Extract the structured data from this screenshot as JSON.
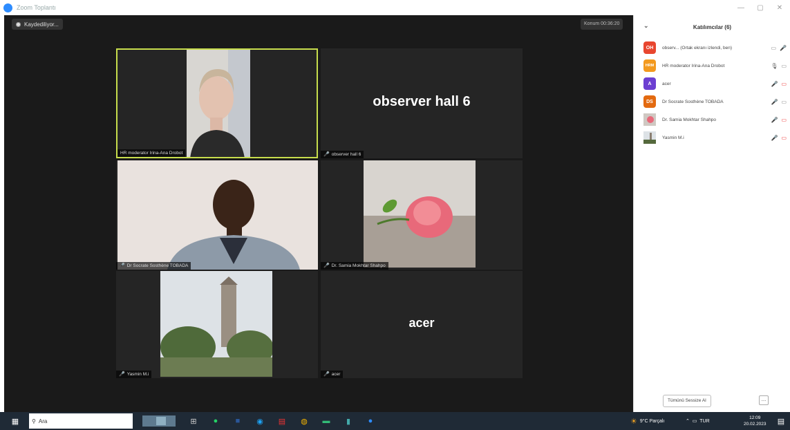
{
  "window": {
    "title": "Zoom Toplantı",
    "controls": [
      "—",
      "▢",
      "✕"
    ]
  },
  "toolbar": {
    "recording_label": "Kaydediliyor...",
    "view_label": "Konum 00:36:20"
  },
  "tiles": [
    {
      "name": "HR moderator Irina-Ana Drobot",
      "muted": false,
      "active": true,
      "kind": "video-woman"
    },
    {
      "name": "observer hall 6",
      "muted": true,
      "active": false,
      "kind": "text",
      "big_text": "observer hall 6"
    },
    {
      "name": "Dr Socrate Sosthène TOBADA",
      "muted": true,
      "active": false,
      "kind": "video-man"
    },
    {
      "name": "Dr. Samia Mokhtar Shahpo",
      "muted": true,
      "active": false,
      "kind": "image-rose"
    },
    {
      "name": "Yasmin M.i",
      "muted": true,
      "active": false,
      "kind": "image-tower"
    },
    {
      "name": "acer",
      "muted": true,
      "active": false,
      "kind": "text",
      "big_text": "acer"
    }
  ],
  "panel": {
    "title": "Katılımcılar (6)",
    "collapse_icon": "chevron-down-icon",
    "participants": [
      {
        "initials": "OH",
        "color": "#e8462f",
        "name": "observ... (Ortak ekranı izlendi, ben)",
        "mic": "off",
        "cam": "on"
      },
      {
        "initials": "HRM",
        "color": "#f39a1f",
        "name": "HR moderator Irina-Ana Drobot",
        "mic": "on",
        "cam": "on"
      },
      {
        "initials": "A",
        "color": "#6c3fd1",
        "name": "acer",
        "mic": "off",
        "cam": "off"
      },
      {
        "initials": "DS",
        "color": "#e36a10",
        "name": "Dr Socrate Sosthène TOBADA",
        "mic": "off",
        "cam": "on"
      },
      {
        "initials": "",
        "color": "#8a6a5a",
        "name": "Dr. Samia Mokhtar Shahpo",
        "mic": "off",
        "cam": "off"
      },
      {
        "initials": "",
        "color": "#667",
        "name": "Yasmin M.i",
        "mic": "off",
        "cam": "off"
      }
    ],
    "invite_label": "Tümünü Sessize Al",
    "more_label": "..."
  },
  "taskbar": {
    "search_placeholder": "Ara",
    "weather": "9°C Parçalı",
    "lang": "TUR",
    "time": "12:09",
    "date": "20.02.2023"
  }
}
